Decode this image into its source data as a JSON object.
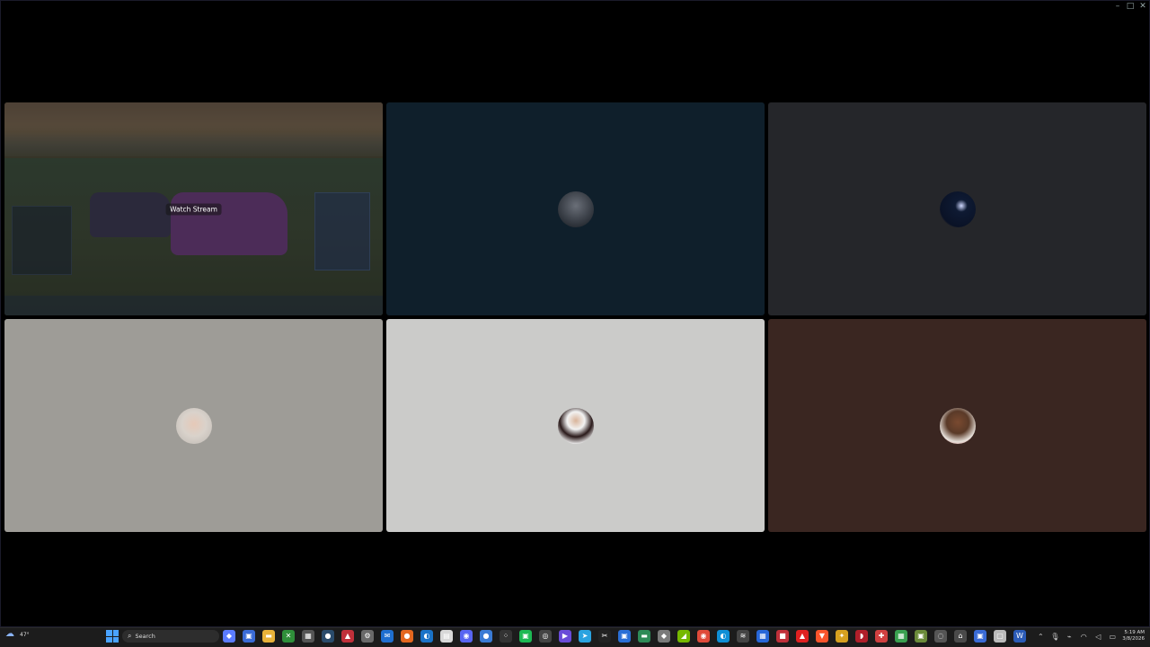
{
  "window": {
    "controls": [
      "minimize",
      "maximize",
      "close"
    ]
  },
  "tiles": [
    {
      "type": "stream",
      "button_label": "Watch Stream",
      "bg": "#3b4433"
    },
    {
      "type": "avatar",
      "bg": "#0f1f2b",
      "avatar_color": "#3a3f47"
    },
    {
      "type": "avatar",
      "bg": "#25262a",
      "avatar_color": "#0e1a33"
    },
    {
      "type": "avatar",
      "bg": "#9e9c97",
      "avatar_color": "#d9d2cb"
    },
    {
      "type": "avatar",
      "bg": "#cbcbc9",
      "avatar_color": "#f2f2f2"
    },
    {
      "type": "avatar",
      "bg": "#3a2621",
      "avatar_color": "#6b4a3a"
    }
  ],
  "taskbar": {
    "weather_temp": "47°",
    "search_placeholder": "Search",
    "apps": [
      {
        "name": "copilot-icon",
        "color": "#5b7cff",
        "glyph": "◆"
      },
      {
        "name": "store-icon",
        "color": "#3a6bd6",
        "glyph": "▣"
      },
      {
        "name": "file-explorer-icon",
        "color": "#e8b23a",
        "glyph": "▬"
      },
      {
        "name": "xbox-icon",
        "color": "#2f8f3a",
        "glyph": "✕"
      },
      {
        "name": "calculator-icon",
        "color": "#555555",
        "glyph": "▦"
      },
      {
        "name": "steam-icon",
        "color": "#2a4b6b",
        "glyph": "●"
      },
      {
        "name": "app-red-icon",
        "color": "#c0303a",
        "glyph": "▲"
      },
      {
        "name": "settings-icon",
        "color": "#6a6a6a",
        "glyph": "⚙"
      },
      {
        "name": "mail-icon",
        "color": "#1f6fd0",
        "glyph": "✉"
      },
      {
        "name": "firefox-icon",
        "color": "#e5671f",
        "glyph": "●"
      },
      {
        "name": "edge-icon",
        "color": "#1a73c8",
        "glyph": "◐"
      },
      {
        "name": "notes-icon",
        "color": "#d8d8d8",
        "glyph": "▤"
      },
      {
        "name": "discord-icon",
        "color": "#5865f2",
        "glyph": "◉"
      },
      {
        "name": "chat-icon",
        "color": "#3a7bd5",
        "glyph": "●"
      },
      {
        "name": "dots-icon",
        "color": "#333333",
        "glyph": "⁘"
      },
      {
        "name": "green-app-icon",
        "color": "#1db954",
        "glyph": "▣"
      },
      {
        "name": "browser-icon",
        "color": "#444444",
        "glyph": "◎"
      },
      {
        "name": "arrow-app-icon",
        "color": "#6a4bd8",
        "glyph": "▶"
      },
      {
        "name": "telegram-icon",
        "color": "#2aa3e0",
        "glyph": "➤"
      },
      {
        "name": "capcut-icon",
        "color": "#222222",
        "glyph": "✂"
      },
      {
        "name": "photos-icon",
        "color": "#2a6fd6",
        "glyph": "▣"
      },
      {
        "name": "folder-green-icon",
        "color": "#2e8b57",
        "glyph": "▬"
      },
      {
        "name": "cube-icon",
        "color": "#7a7a7a",
        "glyph": "◆"
      },
      {
        "name": "nvidia-icon",
        "color": "#76b900",
        "glyph": "◢"
      },
      {
        "name": "chrome-icon",
        "color": "#e04a3a",
        "glyph": "◉"
      },
      {
        "name": "edge-blue-icon",
        "color": "#0f8fd6",
        "glyph": "◐"
      },
      {
        "name": "stream-icon",
        "color": "#444444",
        "glyph": "≋"
      },
      {
        "name": "blue-square-icon",
        "color": "#2767d8",
        "glyph": "▦"
      },
      {
        "name": "red-app-icon",
        "color": "#c0303a",
        "glyph": "■"
      },
      {
        "name": "adobe-icon",
        "color": "#e02020",
        "glyph": "▲"
      },
      {
        "name": "brave-icon",
        "color": "#fb542b",
        "glyph": "▼"
      },
      {
        "name": "star-app-icon",
        "color": "#d6a01f",
        "glyph": "✦"
      },
      {
        "name": "red-logo-icon",
        "color": "#b01f2a",
        "glyph": "◗"
      },
      {
        "name": "gamepad-icon",
        "color": "#d04040",
        "glyph": "✚"
      },
      {
        "name": "green-grid-icon",
        "color": "#3aa050",
        "glyph": "▦"
      },
      {
        "name": "tile-app-icon",
        "color": "#6b8b3a",
        "glyph": "▣"
      },
      {
        "name": "rocket-icon",
        "color": "#555555",
        "glyph": "◌"
      },
      {
        "name": "home-icon",
        "color": "#4a4a4a",
        "glyph": "⌂"
      },
      {
        "name": "bluebox-icon",
        "color": "#3a6bd6",
        "glyph": "▣"
      },
      {
        "name": "white-app-icon",
        "color": "#bbbbbb",
        "glyph": "▢"
      },
      {
        "name": "word-icon",
        "color": "#2b5bb7",
        "glyph": "W"
      }
    ],
    "clock_time": "5:19 AM",
    "clock_date": "3/8/2026"
  }
}
